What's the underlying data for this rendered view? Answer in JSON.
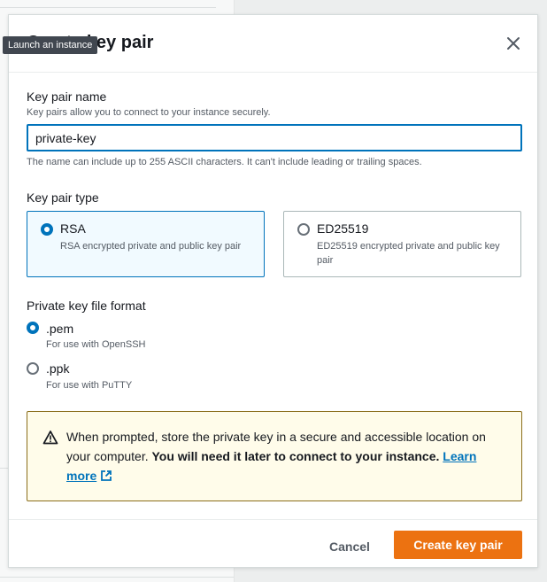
{
  "tooltip": {
    "text": "Launch an instance"
  },
  "modal": {
    "title": "Create key pair",
    "close_icon": "close-icon"
  },
  "key_pair_name": {
    "label": "Key pair name",
    "description": "Key pairs allow you to connect to your instance securely.",
    "value": "private-key",
    "hint": "The name can include up to 255 ASCII characters. It can't include leading or trailing spaces."
  },
  "key_pair_type": {
    "label": "Key pair type",
    "options": [
      {
        "title": "RSA",
        "description": "RSA encrypted private and public key pair",
        "selected": true
      },
      {
        "title": "ED25519",
        "description": "ED25519 encrypted private and public key pair",
        "selected": false
      }
    ]
  },
  "file_format": {
    "label": "Private key file format",
    "options": [
      {
        "title": ".pem",
        "description": "For use with OpenSSH",
        "selected": true
      },
      {
        "title": ".ppk",
        "description": "For use with PuTTY",
        "selected": false
      }
    ]
  },
  "alert": {
    "icon": "warning-icon",
    "text_plain": "When prompted, store the private key in a secure and accessible location on your computer.",
    "text_bold": "You will need it later to connect to your instance.",
    "link_text": "Learn more",
    "link_icon": "external-link-icon"
  },
  "footer": {
    "cancel_label": "Cancel",
    "create_label": "Create key pair"
  },
  "colors": {
    "primary": "#ec7211",
    "accent": "#0073bb",
    "warning_border": "#8b6e1b",
    "warning_bg": "#fffcea"
  }
}
